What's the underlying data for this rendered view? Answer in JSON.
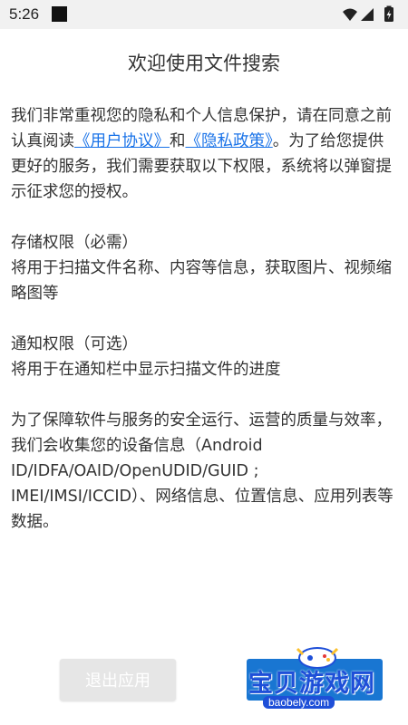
{
  "status_bar": {
    "time": "5:26"
  },
  "title": "欢迎使用文件搜索",
  "intro": {
    "text_before": "我们非常重视您的隐私和个人信息保护，请在同意之前认真阅读",
    "link_user_agreement": "《用户协议》",
    "text_and": "和",
    "link_privacy_policy": "《隐私政策》",
    "text_after": "。为了给您提供更好的服务，我们需要获取以下权限，系统将以弹窗提示征求您的授权。"
  },
  "permissions": [
    {
      "heading": "存储权限（必需）",
      "description": "将用于扫描文件名称、内容等信息，获取图片、视频缩略图等"
    },
    {
      "heading": "通知权限（可选）",
      "description": "将用于在通知栏中显示扫描文件的进度"
    }
  ],
  "collection_notice": "为了保障软件与服务的安全运行、运营的质量与效率，我们会收集您的设备信息（Android ID/IDFA/OAID/OpenUDID/GUID ; IMEI/IMSI/ICCID）、网络信息、位置信息、应用列表等数据。",
  "buttons": {
    "exit_label": "退出应用"
  },
  "watermark": {
    "brand": "宝贝游戏网",
    "domain": "baobely.com"
  },
  "colors": {
    "link": "#1a73e8",
    "agree_button": "#1976d2",
    "exit_button": "#e6e6e6"
  }
}
